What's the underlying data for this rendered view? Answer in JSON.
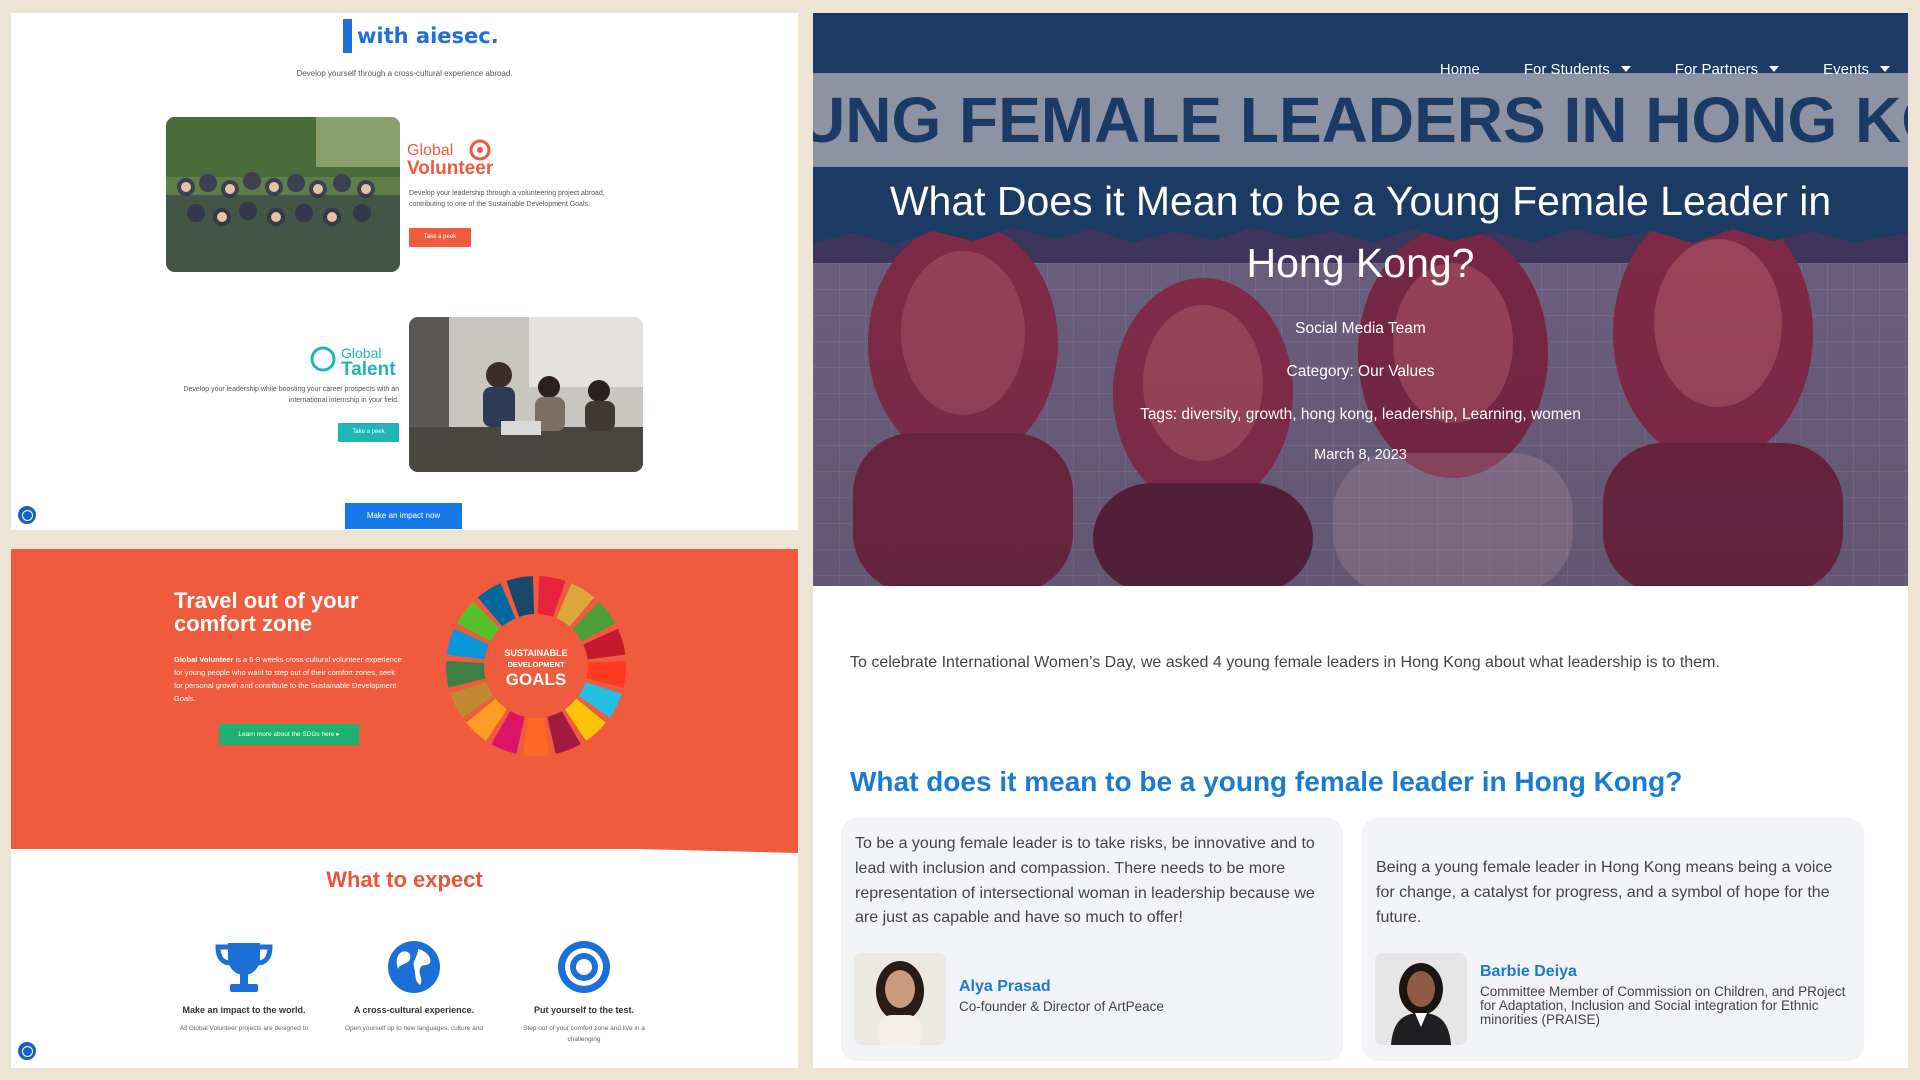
{
  "panel_a": {
    "brand": "with aiesec.",
    "tagline": "Develop yourself through a cross-cultural experience abroad.",
    "volunteer": {
      "logo_small": "Global",
      "logo_big": "Volunteer",
      "description": "Develop your leadership through a volunteering project abroad, contributing to one of the Sustainable Development Goals.",
      "button": "Take a peek",
      "color": "#ef5a3f"
    },
    "talent": {
      "logo_small": "Global",
      "logo_big": "Talent",
      "description": "Develop your leadership while boosting your career prospects with an international internship in your field.",
      "button": "Take a peek",
      "color": "#1fb5b5"
    },
    "impact_button": "Make an impact now"
  },
  "panel_b": {
    "title": "Travel out of your comfort zone",
    "body_bold": "Global Volunteer",
    "body_rest": " is a 6-8 weeks cross-cultural volunteer experience for young people who want to step out of their comfort zones, seek for personal growth and contribute to the Sustainable Development Goals.",
    "sdg_button": "Learn more about the SDGs here",
    "sdg_title_1": "SUSTAINABLE",
    "sdg_title_2": "DEVELOPMENT",
    "sdg_title_3": "GOALS",
    "expect_title": "What to expect",
    "items": [
      {
        "heading": "Make an impact to the world.",
        "text": "All Global Volunteer projects are designed to",
        "icon": "trophy-icon"
      },
      {
        "heading": "A cross-cultural experience.",
        "text": "Open yourself up to new languages, culture and",
        "icon": "globe-icon"
      },
      {
        "heading": "Put yourself to the test.",
        "text": "Step out of your comfort zone and live in a challenging",
        "icon": "target-icon"
      }
    ]
  },
  "article": {
    "nav": [
      {
        "label": "Home",
        "has_caret": false
      },
      {
        "label": "For Students",
        "has_caret": true
      },
      {
        "label": "For Partners",
        "has_caret": true
      },
      {
        "label": "Events",
        "has_caret": true
      }
    ],
    "banner_text": "UNG FEMALE LEADERS IN HONG KO",
    "title": "What Does it Mean to be a Young Female Leader in Hong Kong?",
    "author": "Social Media Team",
    "category": "Category: Our Values",
    "tags": "Tags: diversity, growth, hong kong, leadership, Learning, women",
    "date": "March 8, 2023",
    "intro": "To celebrate International Women’s Day, we asked 4 young female leaders in Hong Kong about what leadership is to them.",
    "question_heading": "What does it mean to be a young female leader in Hong Kong?",
    "quotes": [
      {
        "text": "To be a young female leader is to take risks, be innovative and to lead with inclusion and compassion. There needs to be more representation of intersectional woman in leadership because we are just as capable and have so much to offer!",
        "name": "Alya Prasad",
        "role": "Co-founder & Director of ArtPeace"
      },
      {
        "text": "Being a young female leader in Hong Kong means being a voice for change, a catalyst for progress, and a symbol of hope for the future.",
        "name": "Barbie Deiya",
        "role": "Committee Member of Commission on Children, and PRoject for Adaptation, Inclusion and Social integration for Ethnic minorities (PRAISE)"
      }
    ]
  },
  "colors": {
    "aiesec_blue": "#1e6fd9",
    "orange": "#f05a3d",
    "heading_blue": "#1b7bd0",
    "navy": "#1b3a64"
  }
}
